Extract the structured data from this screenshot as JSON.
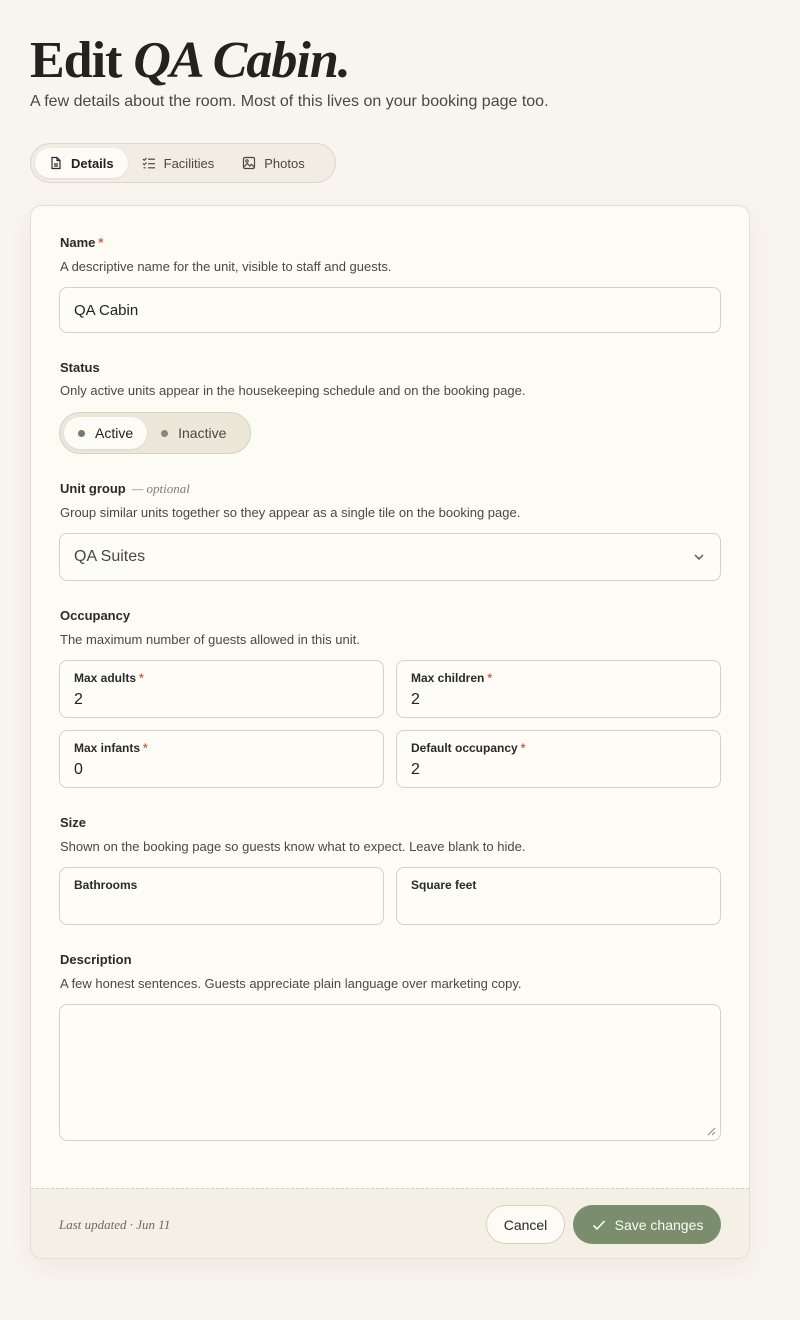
{
  "header": {
    "title_prefix": "Edit",
    "title_name": "QA Cabin.",
    "subtitle": "A few details about the room. Most of this lives on your booking page too."
  },
  "tabs": [
    {
      "label": "Details",
      "icon": "document-icon",
      "active": true
    },
    {
      "label": "Facilities",
      "icon": "checklist-icon",
      "active": false
    },
    {
      "label": "Photos",
      "icon": "image-icon",
      "active": false
    }
  ],
  "form": {
    "name": {
      "label": "Name",
      "required_mark": "*",
      "hint": "A descriptive name for the unit, visible to staff and guests.",
      "value": "QA Cabin"
    },
    "status": {
      "label": "Status",
      "hint": "Only active units appear in the housekeeping schedule and on the booking page.",
      "options": [
        "Active",
        "Inactive"
      ],
      "selected": "Active"
    },
    "unit_group": {
      "label": "Unit group",
      "optional": "— optional",
      "hint": "Group similar units together so they appear as a single tile on the booking page.",
      "value": "QA Suites"
    },
    "occupancy": {
      "label": "Occupancy",
      "hint": "The maximum number of guests allowed in this unit.",
      "fields": [
        {
          "label": "Max adults",
          "required_mark": "*",
          "value": "2"
        },
        {
          "label": "Max children",
          "required_mark": "*",
          "value": "2"
        },
        {
          "label": "Max infants",
          "required_mark": "*",
          "value": "0"
        },
        {
          "label": "Default occupancy",
          "required_mark": "*",
          "value": "2"
        }
      ]
    },
    "size": {
      "label": "Size",
      "hint": "Shown on the booking page so guests know what to expect. Leave blank to hide.",
      "fields": [
        {
          "label": "Bathrooms",
          "value": ""
        },
        {
          "label": "Square feet",
          "value": ""
        }
      ]
    },
    "description": {
      "label": "Description",
      "hint": "A few honest sentences. Guests appreciate plain language over marketing copy.",
      "value": ""
    }
  },
  "footer": {
    "last_updated": "Last updated · Jun 11",
    "cancel_label": "Cancel",
    "save_label": "Save changes"
  },
  "colors": {
    "accent": "#7a8d6c",
    "required": "#d2603f",
    "active_dot": "#6f7f62",
    "inactive_dot": "#8a867c"
  }
}
